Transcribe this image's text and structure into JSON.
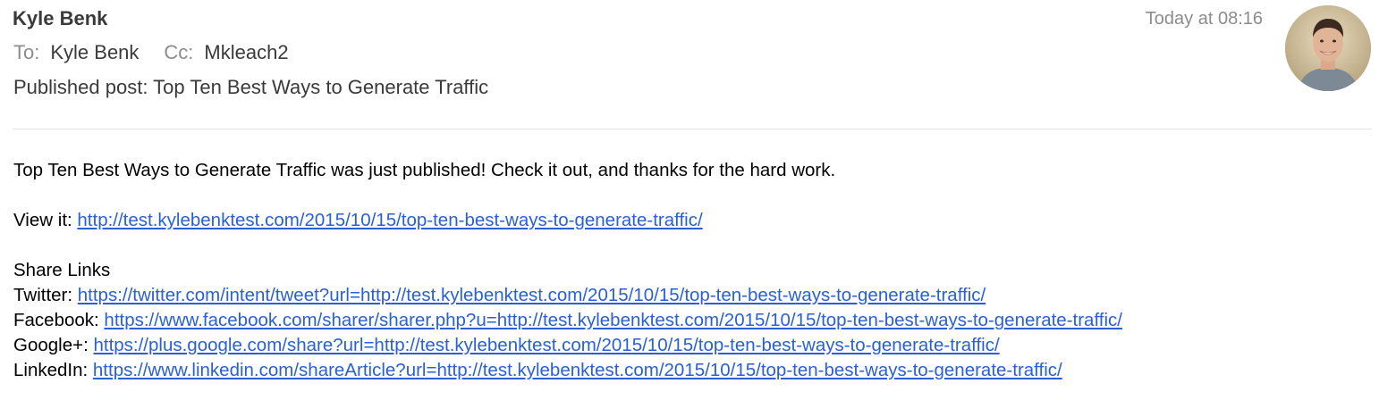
{
  "header": {
    "sender": "Kyle Benk",
    "timestamp": "Today at 08:16",
    "to_label": "To:",
    "to_value": "Kyle Benk",
    "cc_label": "Cc:",
    "cc_value": "Mkleach2",
    "subject": "Published post: Top Ten Best Ways to Generate Traffic",
    "avatar_icon": "person-avatar"
  },
  "body": {
    "intro": "Top Ten Best Ways to Generate Traffic was just published! Check it out, and thanks for the hard work.",
    "view_label": "View it: ",
    "view_url": "http://test.kylebenktest.com/2015/10/15/top-ten-best-ways-to-generate-traffic/",
    "share_heading": "Share Links",
    "share_links": [
      {
        "label": "Twitter: ",
        "url": "https://twitter.com/intent/tweet?url=http://test.kylebenktest.com/2015/10/15/top-ten-best-ways-to-generate-traffic/"
      },
      {
        "label": "Facebook: ",
        "url": "https://www.facebook.com/sharer/sharer.php?u=http://test.kylebenktest.com/2015/10/15/top-ten-best-ways-to-generate-traffic/"
      },
      {
        "label": "Google+: ",
        "url": "https://plus.google.com/share?url=http://test.kylebenktest.com/2015/10/15/top-ten-best-ways-to-generate-traffic/"
      },
      {
        "label": "LinkedIn: ",
        "url": "https://www.linkedin.com/shareArticle?url=http://test.kylebenktest.com/2015/10/15/top-ten-best-ways-to-generate-traffic/"
      }
    ]
  },
  "colors": {
    "link": "#2a5fd6",
    "meta_gray": "#8c8c8c",
    "text_dark": "#3a3a3a"
  }
}
